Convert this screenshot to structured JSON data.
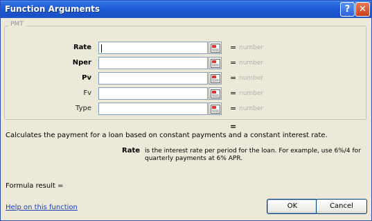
{
  "window": {
    "title": "Function Arguments",
    "help_glyph": "?",
    "close_glyph": "✕"
  },
  "function_group": {
    "label": "PMT"
  },
  "arguments": [
    {
      "label": "Rate",
      "value": "",
      "hint": "number",
      "required": true
    },
    {
      "label": "Nper",
      "value": "",
      "hint": "number",
      "required": true
    },
    {
      "label": "Pv",
      "value": "",
      "hint": "number",
      "required": true
    },
    {
      "label": "Fv",
      "value": "",
      "hint": "number",
      "required": false
    },
    {
      "label": "Type",
      "value": "",
      "hint": "number",
      "required": false
    }
  ],
  "result_equals": "=",
  "description": "Calculates the payment for a loan based on constant payments and a constant interest rate.",
  "arg_description": {
    "name": "Rate",
    "text": "is the interest rate per period for the loan. For example, use 6%/4 for quarterly payments at 6% APR."
  },
  "formula_result": "Formula result =",
  "help_link": "Help on this function",
  "buttons": {
    "ok": "OK",
    "cancel": "Cancel"
  },
  "colors": {
    "titlebar": "#1f5ad6",
    "dialog_bg": "#ece9d8",
    "hint": "#b0b0b0",
    "link": "#1a3fb8"
  }
}
